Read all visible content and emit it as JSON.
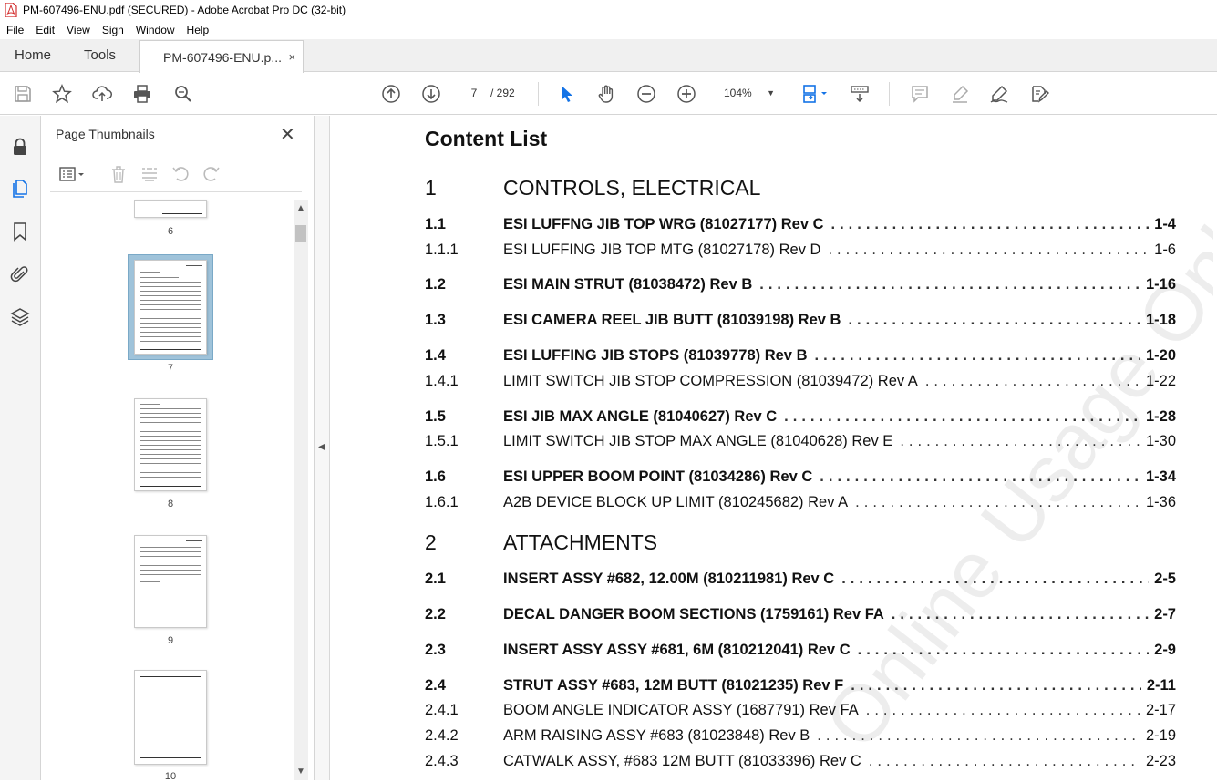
{
  "window": {
    "title": "PM-607496-ENU.pdf (SECURED) - Adobe Acrobat Pro DC (32-bit)"
  },
  "menu": [
    "File",
    "Edit",
    "View",
    "Sign",
    "Window",
    "Help"
  ],
  "tabs": {
    "home": "Home",
    "tools": "Tools",
    "document": "PM-607496-ENU.p...",
    "close": "×"
  },
  "toolbar": {
    "current_page": "7",
    "page_total": "/ 292",
    "zoom": "104%",
    "zoom_caret": "▼",
    "icons": [
      "save-icon",
      "star-icon",
      "upload-icon",
      "print-icon",
      "find-zoom-icon",
      "prev-page-icon",
      "next-page-icon",
      "select-cursor-icon",
      "hand-icon",
      "zoom-out-icon",
      "zoom-in-icon",
      "fit-page-icon",
      "scroll-mode-icon",
      "comment-icon",
      "highlight-icon",
      "sign-icon",
      "share-icon"
    ]
  },
  "rail": {
    "icons": [
      "lock-icon",
      "pages-icon",
      "bookmark-icon",
      "attachment-icon",
      "layers-icon"
    ]
  },
  "thumbnails": {
    "title": "Page Thumbnails",
    "close": "✕",
    "pages": [
      "6",
      "7",
      "8",
      "9",
      "10"
    ],
    "selected": "7"
  },
  "colors": {
    "accent": "#1473e6",
    "selection": "#9fc3da",
    "pdf_red": "#d32f2f"
  },
  "document": {
    "title": "Content List",
    "watermark": "Online Usage Only",
    "sections": [
      {
        "num": "1",
        "name": "CONTROLS, ELECTRICAL",
        "entries": [
          {
            "num": "1.1",
            "text": "ESI LUFFNG JIB TOP WRG (81027177) Rev C",
            "page": "1-4",
            "bold": true
          },
          {
            "num": "1.1.1",
            "text": "ESI LUFFING JIB TOP MTG (81027178) Rev D",
            "page": "1-6",
            "bold": false
          },
          {
            "num": "1.2",
            "text": "ESI MAIN STRUT (81038472) Rev B",
            "page": "1-16",
            "bold": true
          },
          {
            "num": "1.3",
            "text": "ESI CAMERA REEL JIB BUTT (81039198) Rev B",
            "page": "1-18",
            "bold": true
          },
          {
            "num": "1.4",
            "text": "ESI LUFFING JIB STOPS (81039778) Rev B",
            "page": "1-20",
            "bold": true
          },
          {
            "num": "1.4.1",
            "text": "LIMIT SWITCH JIB STOP COMPRESSION (81039472) Rev A",
            "page": "1-22",
            "bold": false
          },
          {
            "num": "1.5",
            "text": "ESI JIB MAX ANGLE (81040627) Rev C",
            "page": "1-28",
            "bold": true
          },
          {
            "num": "1.5.1",
            "text": "LIMIT SWITCH JIB STOP MAX ANGLE (81040628) Rev E",
            "page": "1-30",
            "bold": false
          },
          {
            "num": "1.6",
            "text": "ESI UPPER BOOM POINT (81034286) Rev C",
            "page": "1-34",
            "bold": true
          },
          {
            "num": "1.6.1",
            "text": "A2B DEVICE BLOCK UP LIMIT (810245682) Rev A",
            "page": "1-36",
            "bold": false
          }
        ]
      },
      {
        "num": "2",
        "name": "ATTACHMENTS",
        "entries": [
          {
            "num": "2.1",
            "text": "INSERT ASSY #682, 12.00M (810211981) Rev C",
            "page": "2-5",
            "bold": true
          },
          {
            "num": "2.2",
            "text": "DECAL DANGER BOOM SECTIONS (1759161) Rev FA",
            "page": "2-7",
            "bold": true
          },
          {
            "num": "2.3",
            "text": "INSERT ASSY ASSY #681, 6M (810212041) Rev C",
            "page": "2-9",
            "bold": true
          },
          {
            "num": "2.4",
            "text": "STRUT ASSY #683, 12M BUTT (81021235) Rev F",
            "page": "2-11",
            "bold": true
          },
          {
            "num": "2.4.1",
            "text": "BOOM ANGLE INDICATOR ASSY (1687791) Rev FA",
            "page": "2-17",
            "bold": false
          },
          {
            "num": "2.4.2",
            "text": "ARM RAISING ASSY #683 (81023848) Rev B",
            "page": "2-19",
            "bold": false
          },
          {
            "num": "2.4.3",
            "text": "CATWALK ASSY, #683 12M BUTT (81033396) Rev C",
            "page": "2-23",
            "bold": false
          }
        ]
      }
    ]
  }
}
